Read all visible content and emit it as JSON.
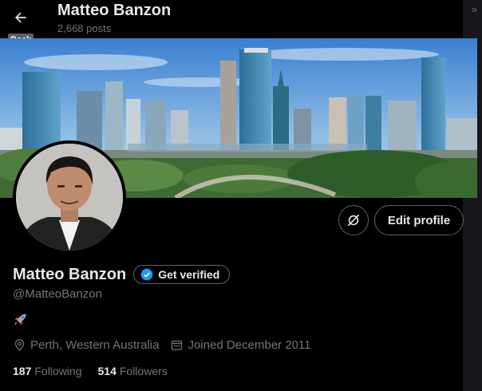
{
  "header": {
    "back_tooltip": "Back",
    "name": "Matteo Banzon",
    "posts": "2,668 posts",
    "chevron": "»"
  },
  "profile": {
    "display_name": "Matteo Banzon",
    "verify_label": "Get verified",
    "handle": "@MatteoBanzon",
    "bio_icon": "rocket-icon",
    "location": "Perth, Western Australia",
    "joined": "Joined December 2011",
    "following_count": "187",
    "following_label": "Following",
    "followers_count": "514",
    "followers_label": "Followers"
  },
  "actions": {
    "edit_label": "Edit profile",
    "icon_button": "unlink-icon"
  },
  "colors": {
    "background": "#000000",
    "text": "#e7e9ea",
    "muted": "#71767b",
    "border": "#536471",
    "verified_blue": "#1d9bf0"
  }
}
